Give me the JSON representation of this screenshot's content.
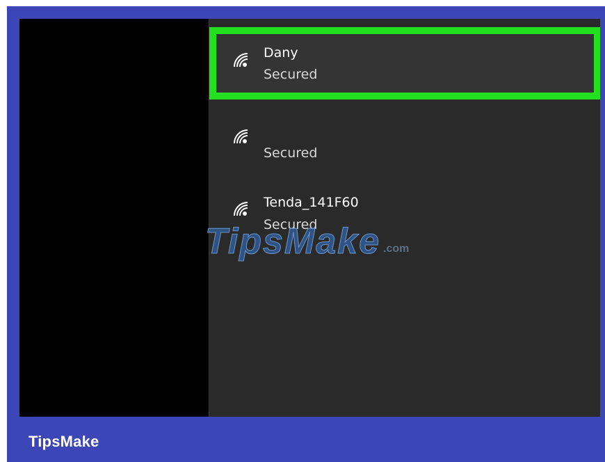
{
  "networks": [
    {
      "name": "Dany",
      "status": "Secured",
      "icon": "wifi-secured-icon",
      "selected": true
    },
    {
      "name": "",
      "status": "Secured",
      "icon": "wifi-secured-icon",
      "selected": false
    },
    {
      "name": "Tenda_141F60",
      "status": "Secured",
      "icon": "wifi-secured-icon",
      "selected": false
    }
  ],
  "watermark": {
    "text": "TipsMake",
    "suffix": ".com"
  },
  "footer": {
    "brand": "TipsMake"
  },
  "colors": {
    "frame": "#3c46b6",
    "panel": "#2a2a2a",
    "highlight": "#22e01e",
    "watermark": "#2f5f9d"
  }
}
